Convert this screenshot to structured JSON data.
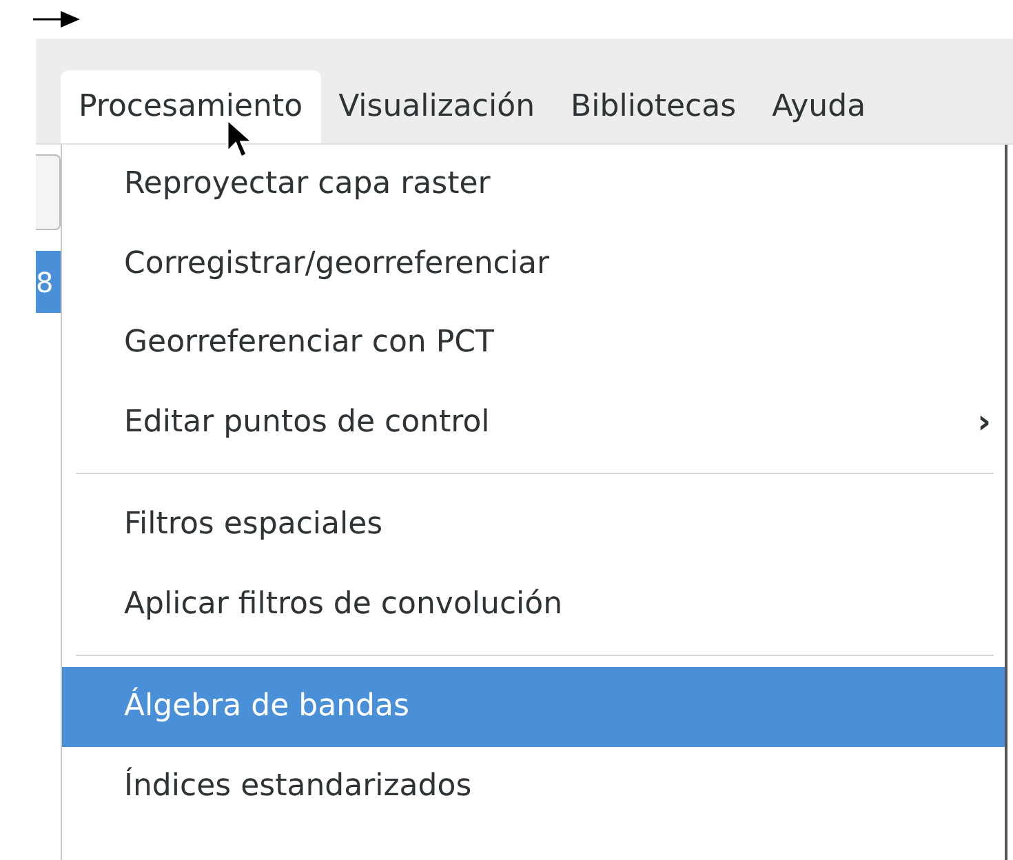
{
  "menubar": [
    {
      "label": "Procesamiento",
      "selected": true
    },
    {
      "label": "Visualización",
      "selected": false
    },
    {
      "label": "Bibliotecas",
      "selected": false
    },
    {
      "label": "Ayuda",
      "selected": false
    }
  ],
  "side_cell": "8",
  "menu": [
    {
      "kind": "item",
      "label": "Reproyectar capa raster",
      "selected": false
    },
    {
      "kind": "item",
      "label": "Corregistrar/georreferenciar",
      "selected": false
    },
    {
      "kind": "item",
      "label": "Georreferenciar con PCT",
      "selected": false
    },
    {
      "kind": "submenu",
      "label": "Editar puntos de control",
      "selected": false,
      "arrow": "›"
    },
    {
      "kind": "separator"
    },
    {
      "kind": "item",
      "label": "Filtros espaciales",
      "selected": false
    },
    {
      "kind": "item",
      "label": "Aplicar filtros de convolución",
      "selected": false
    },
    {
      "kind": "separator"
    },
    {
      "kind": "item",
      "label": "Álgebra de bandas",
      "selected": true
    },
    {
      "kind": "item",
      "label": "Índices estandarizados",
      "selected": false
    }
  ]
}
